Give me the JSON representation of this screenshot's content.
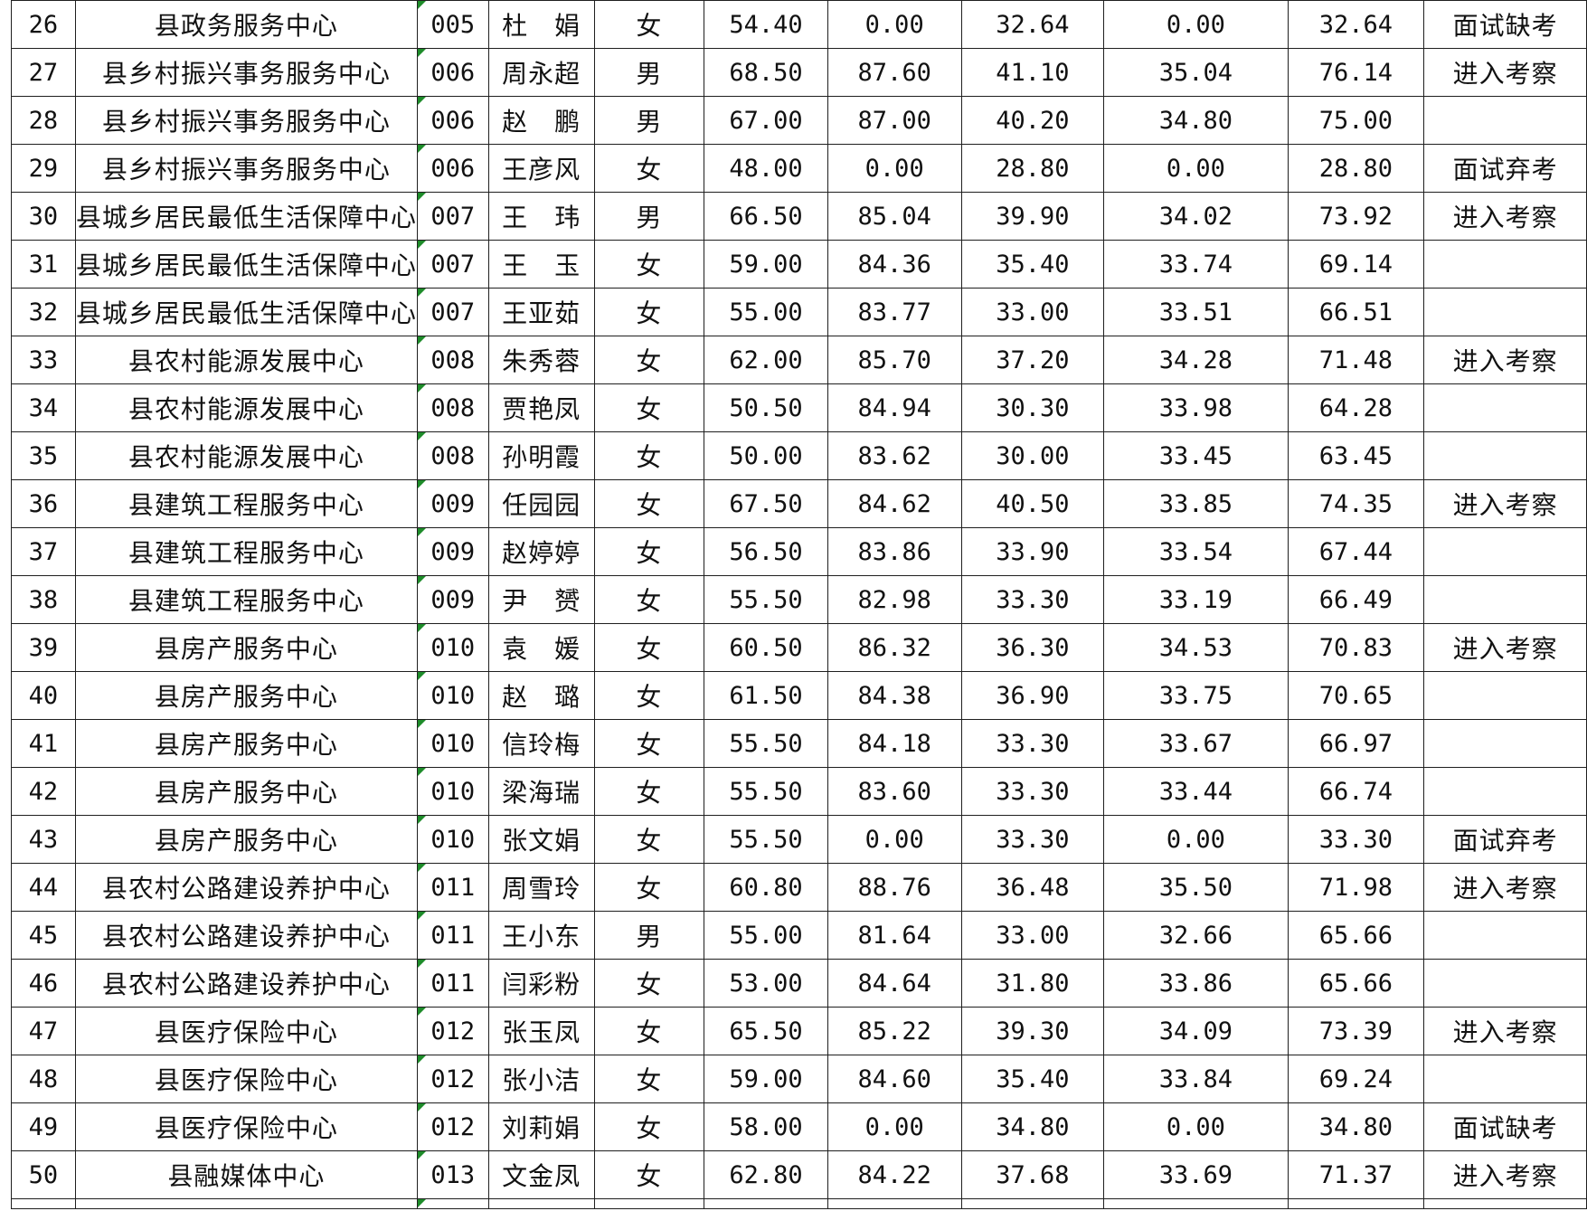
{
  "table": {
    "rows": [
      [
        "26",
        "县政务服务中心",
        "005",
        "杜　娟",
        "女",
        "54.40",
        "0.00",
        "32.64",
        "0.00",
        "32.64",
        "面试缺考"
      ],
      [
        "27",
        "县乡村振兴事务服务中心",
        "006",
        "周永超",
        "男",
        "68.50",
        "87.60",
        "41.10",
        "35.04",
        "76.14",
        "进入考察"
      ],
      [
        "28",
        "县乡村振兴事务服务中心",
        "006",
        "赵　鹏",
        "男",
        "67.00",
        "87.00",
        "40.20",
        "34.80",
        "75.00",
        ""
      ],
      [
        "29",
        "县乡村振兴事务服务中心",
        "006",
        "王彦风",
        "女",
        "48.00",
        "0.00",
        "28.80",
        "0.00",
        "28.80",
        "面试弃考"
      ],
      [
        "30",
        "县城乡居民最低生活保障中心",
        "007",
        "王　玮",
        "男",
        "66.50",
        "85.04",
        "39.90",
        "34.02",
        "73.92",
        "进入考察"
      ],
      [
        "31",
        "县城乡居民最低生活保障中心",
        "007",
        "王　玉",
        "女",
        "59.00",
        "84.36",
        "35.40",
        "33.74",
        "69.14",
        ""
      ],
      [
        "32",
        "县城乡居民最低生活保障中心",
        "007",
        "王亚茹",
        "女",
        "55.00",
        "83.77",
        "33.00",
        "33.51",
        "66.51",
        ""
      ],
      [
        "33",
        "县农村能源发展中心",
        "008",
        "朱秀蓉",
        "女",
        "62.00",
        "85.70",
        "37.20",
        "34.28",
        "71.48",
        "进入考察"
      ],
      [
        "34",
        "县农村能源发展中心",
        "008",
        "贾艳凤",
        "女",
        "50.50",
        "84.94",
        "30.30",
        "33.98",
        "64.28",
        ""
      ],
      [
        "35",
        "县农村能源发展中心",
        "008",
        "孙明霞",
        "女",
        "50.00",
        "83.62",
        "30.00",
        "33.45",
        "63.45",
        ""
      ],
      [
        "36",
        "县建筑工程服务中心",
        "009",
        "任园园",
        "女",
        "67.50",
        "84.62",
        "40.50",
        "33.85",
        "74.35",
        "进入考察"
      ],
      [
        "37",
        "县建筑工程服务中心",
        "009",
        "赵婷婷",
        "女",
        "56.50",
        "83.86",
        "33.90",
        "33.54",
        "67.44",
        ""
      ],
      [
        "38",
        "县建筑工程服务中心",
        "009",
        "尹　赟",
        "女",
        "55.50",
        "82.98",
        "33.30",
        "33.19",
        "66.49",
        ""
      ],
      [
        "39",
        "县房产服务中心",
        "010",
        "袁　媛",
        "女",
        "60.50",
        "86.32",
        "36.30",
        "34.53",
        "70.83",
        "进入考察"
      ],
      [
        "40",
        "县房产服务中心",
        "010",
        "赵　璐",
        "女",
        "61.50",
        "84.38",
        "36.90",
        "33.75",
        "70.65",
        ""
      ],
      [
        "41",
        "县房产服务中心",
        "010",
        "信玲梅",
        "女",
        "55.50",
        "84.18",
        "33.30",
        "33.67",
        "66.97",
        ""
      ],
      [
        "42",
        "县房产服务中心",
        "010",
        "梁海瑞",
        "女",
        "55.50",
        "83.60",
        "33.30",
        "33.44",
        "66.74",
        ""
      ],
      [
        "43",
        "县房产服务中心",
        "010",
        "张文娟",
        "女",
        "55.50",
        "0.00",
        "33.30",
        "0.00",
        "33.30",
        "面试弃考"
      ],
      [
        "44",
        "县农村公路建设养护中心",
        "011",
        "周雪玲",
        "女",
        "60.80",
        "88.76",
        "36.48",
        "35.50",
        "71.98",
        "进入考察"
      ],
      [
        "45",
        "县农村公路建设养护中心",
        "011",
        "王小东",
        "男",
        "55.00",
        "81.64",
        "33.00",
        "32.66",
        "65.66",
        ""
      ],
      [
        "46",
        "县农村公路建设养护中心",
        "011",
        "闫彩粉",
        "女",
        "53.00",
        "84.64",
        "31.80",
        "33.86",
        "65.66",
        ""
      ],
      [
        "47",
        "县医疗保险中心",
        "012",
        "张玉凤",
        "女",
        "65.50",
        "85.22",
        "39.30",
        "34.09",
        "73.39",
        "进入考察"
      ],
      [
        "48",
        "县医疗保险中心",
        "012",
        "张小洁",
        "女",
        "59.00",
        "84.60",
        "35.40",
        "33.84",
        "69.24",
        ""
      ],
      [
        "49",
        "县医疗保险中心",
        "012",
        "刘莉娟",
        "女",
        "58.00",
        "0.00",
        "34.80",
        "0.00",
        "34.80",
        "面试缺考"
      ],
      [
        "50",
        "县融媒体中心",
        "013",
        "文金凤",
        "女",
        "62.80",
        "84.22",
        "37.68",
        "33.69",
        "71.37",
        "进入考察"
      ]
    ]
  },
  "colors": {
    "grid": "#1f1f1f",
    "text": "#111111",
    "indicator": "#1e8c2a"
  }
}
